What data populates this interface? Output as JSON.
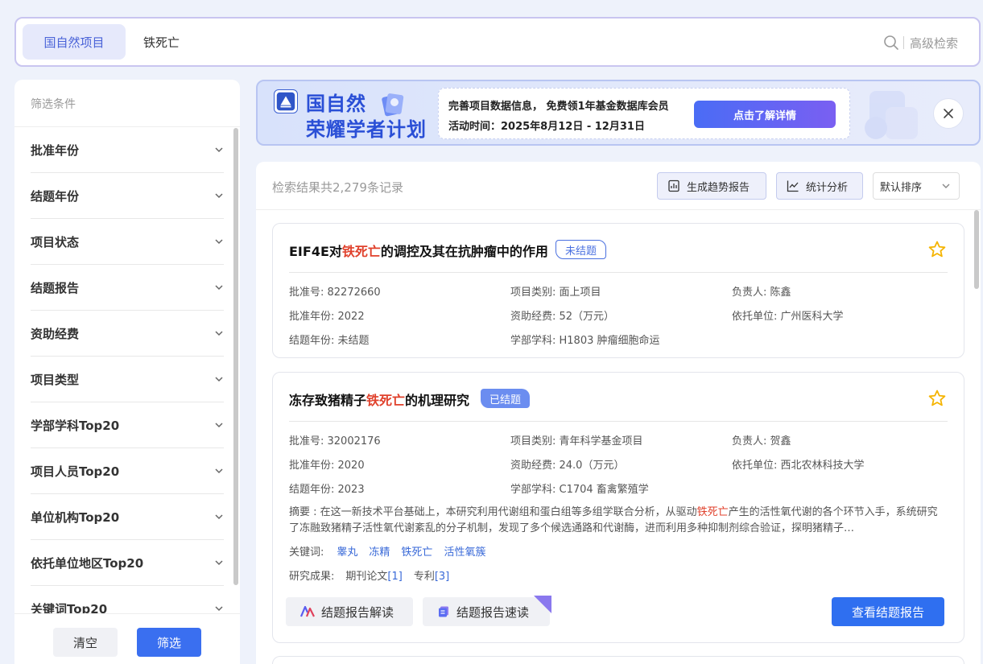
{
  "search": {
    "scope_label": "国自然项目",
    "query": "铁死亡",
    "advanced_label": "高级检索"
  },
  "sidebar": {
    "title": "筛选条件",
    "filters": [
      {
        "label": "批准年份"
      },
      {
        "label": "结题年份"
      },
      {
        "label": "项目状态"
      },
      {
        "label": "结题报告"
      },
      {
        "label": "资助经费"
      },
      {
        "label": "项目类型"
      },
      {
        "label": "学部学科Top20"
      },
      {
        "label": "项目人员Top20"
      },
      {
        "label": "单位机构Top20"
      },
      {
        "label": "依托单位地区Top20"
      },
      {
        "label": "关键词Top20"
      }
    ],
    "clear_label": "清空",
    "filter_label": "筛选"
  },
  "banner": {
    "title_line1": "国自然",
    "title_line2": "荣耀学者计划",
    "info_line1": "完善项目数据信息， 免费领1年基金数据库会员",
    "info_line2": "活动时间：2025年8月12日 - 12月31日",
    "cta_label": "点击了解详情"
  },
  "results": {
    "count_text": "检索结果共2,279条记录",
    "trend_report_label": "生成趋势报告",
    "stats_label": "统计分析",
    "sort_label": "默认排序",
    "items": [
      {
        "title_pre": "EIF4E对",
        "title_hl": "铁死亡",
        "title_post": "的调控及其在抗肿瘤中的作用",
        "status": "未结题",
        "approval_no": "批准号: 82272660",
        "category": "项目类别: 面上项目",
        "leader": "负责人: 陈鑫",
        "approval_year": "批准年份: 2022",
        "funding": "资助经费: 52（万元）",
        "institution": "依托单位: 广州医科大学",
        "end_year": "结题年份: 未结题",
        "discipline": "学部学科: H1803 肿瘤细胞命运"
      },
      {
        "title_pre": "冻存致猪精子",
        "title_hl": "铁死亡",
        "title_post": "的机理研究",
        "status": "已结题",
        "approval_no": "批准号: 32002176",
        "category": "项目类别: 青年科学基金项目",
        "leader": "负责人: 贺鑫",
        "approval_year": "批准年份: 2020",
        "funding": "资助经费: 24.0（万元）",
        "institution": "依托单位: 西北农林科技大学",
        "end_year": "结题年份: 2023",
        "discipline": "学部学科: C1704 畜禽繁殖学",
        "abstract_pre": "摘要 : 在这一新技术平台基础上，本研究利用代谢组和蛋白组等多组学联合分析，从驱动",
        "abstract_hl": "铁死亡",
        "abstract_post": "产生的活性氧代谢的各个环节入手，系统研究了冻融致猪精子活性氧代谢紊乱的分子机制，发现了多个候选通路和代谢酶，进而利用多种抑制剂综合验证，探明猪精子…",
        "keywords_label": "关键词:",
        "keywords": [
          "睾丸",
          "冻精",
          "铁死亡",
          "活性氧簇"
        ],
        "outputs_label": "研究成果:",
        "outputs": [
          {
            "name": "期刊论文",
            "count": "[1]"
          },
          {
            "name": "专利",
            "count": "[3]"
          }
        ],
        "interp_label": "结题报告解读",
        "quick_label": "结题报告速读",
        "view_report_label": "查看结题报告"
      }
    ]
  },
  "colors": {
    "primary": "#3a6ff0",
    "highlight": "#e0412c",
    "star": "#f5b400"
  }
}
